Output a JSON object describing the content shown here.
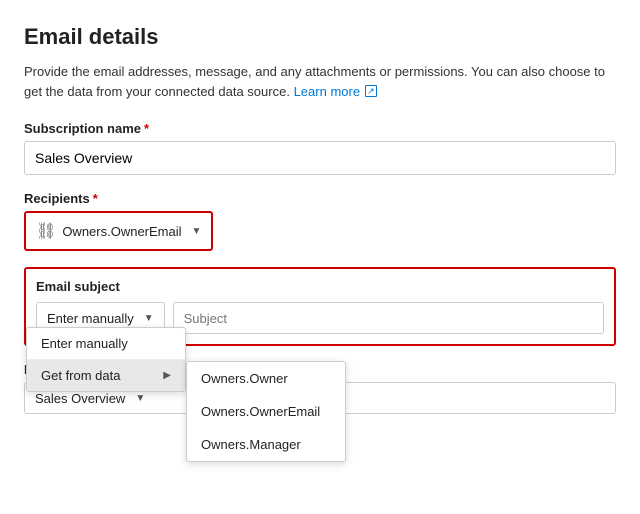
{
  "page": {
    "title": "Email details",
    "description": "Provide the email addresses, message, and any attachments or permissions. You can also choose to get the data from your connected data source.",
    "learn_more": "Learn more"
  },
  "subscription_name": {
    "label": "Subscription name",
    "required": true,
    "value": "Sales Overview"
  },
  "recipients": {
    "label": "Recipients",
    "required": true,
    "value": "Owners.OwnerEmail",
    "chain_icon": "🔗"
  },
  "email_subject": {
    "label": "Email subject",
    "dropdown_label": "Enter manually",
    "placeholder": "Subject",
    "menu_items": [
      {
        "id": "enter-manually",
        "label": "Enter manually",
        "has_submenu": false
      },
      {
        "id": "get-from-data",
        "label": "Get from data",
        "has_submenu": true
      }
    ],
    "submenu_items": [
      {
        "id": "owners-owner",
        "label": "Owners.Owner"
      },
      {
        "id": "owners-owner-email",
        "label": "Owners.OwnerEmail"
      },
      {
        "id": "owners-manager",
        "label": "Owners.Manager"
      }
    ]
  },
  "report_page": {
    "label": "Report page",
    "value": "Sales Overview"
  }
}
